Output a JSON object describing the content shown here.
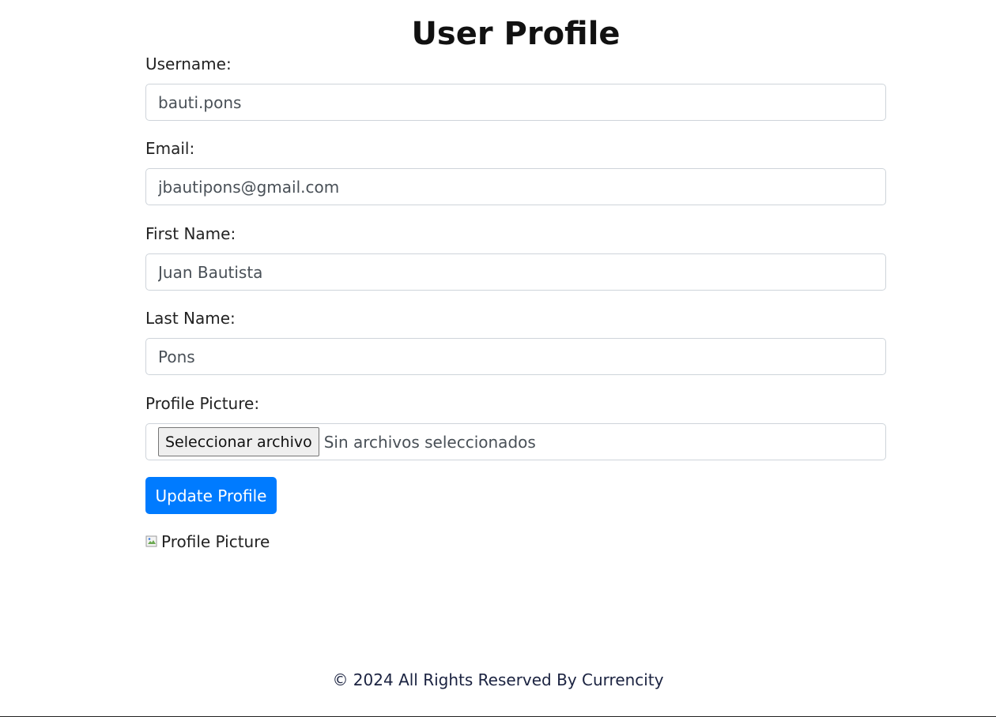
{
  "page": {
    "title": "User Profile"
  },
  "form": {
    "username": {
      "label": "Username:",
      "value": "bauti.pons"
    },
    "email": {
      "label": "Email:",
      "value": "jbautipons@gmail.com"
    },
    "first_name": {
      "label": "First Name:",
      "value": "Juan Bautista"
    },
    "last_name": {
      "label": "Last Name:",
      "value": "Pons"
    },
    "profile_picture": {
      "label": "Profile Picture:",
      "button_label": "Seleccionar archivo",
      "status": "Sin archivos seleccionados"
    },
    "submit_label": "Update Profile"
  },
  "profile_image": {
    "alt": "Profile Picture"
  },
  "footer": {
    "text": "© 2024 All Rights Reserved By Currencity"
  },
  "colors": {
    "primary": "#007bff",
    "input_border": "#ced4da",
    "input_text": "#495057"
  }
}
